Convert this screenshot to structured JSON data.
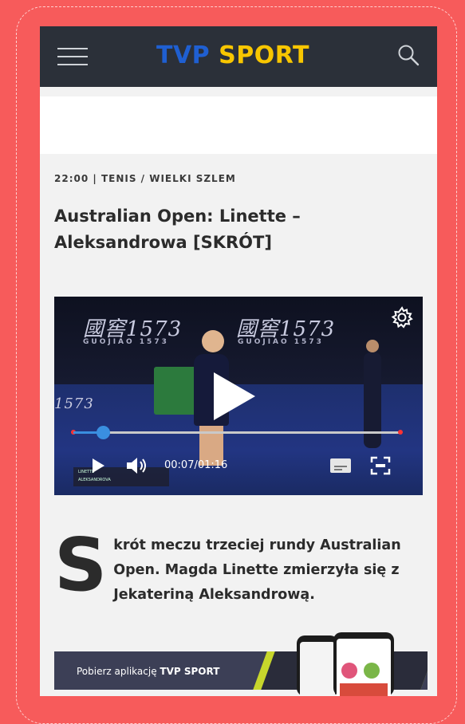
{
  "header": {
    "logo_tvp": "TVP",
    "logo_sport": "SPORT",
    "menu_icon": "hamburger-menu-icon",
    "search_icon": "search-icon"
  },
  "article": {
    "time": "22:00",
    "category": "TENIS / WIELKI SZLEM",
    "title": "Australian Open: Linette – Aleksandrowa [SKRÓT]",
    "lead_dropcap": "S",
    "lead_rest": "krót meczu trzeciej rundy Australian Open. Magda Linette zmierzyła się z Jekateriną Aleksandrową."
  },
  "video": {
    "time_display": "00:07/01:16",
    "progress_fraction": 0.09,
    "banner_text_1": "國窖1573",
    "banner_sub_1": "GUOJIAO 1573",
    "banner_text_2": "國窖1573",
    "banner_sub_2": "GUOJIAO 1573",
    "side_text": "1573",
    "scoreboard_player_1": "LINETTE",
    "scoreboard_player_2": "ALEKSANDROVA",
    "icons": {
      "settings": "gear-icon",
      "play_big": "play-icon",
      "play": "play-icon",
      "volume": "volume-icon",
      "captions": "captions-icon",
      "fullscreen": "fullscreen-icon"
    }
  },
  "app_banner": {
    "text_prefix": "Pobierz aplikację",
    "text_bold": "TVP SPORT"
  },
  "colors": {
    "page_background": "#f75b5b",
    "header_background": "#2b3039",
    "logo_tvp": "#1f5fd1",
    "logo_sport": "#f8c600",
    "progress": "#3a8fe0"
  }
}
